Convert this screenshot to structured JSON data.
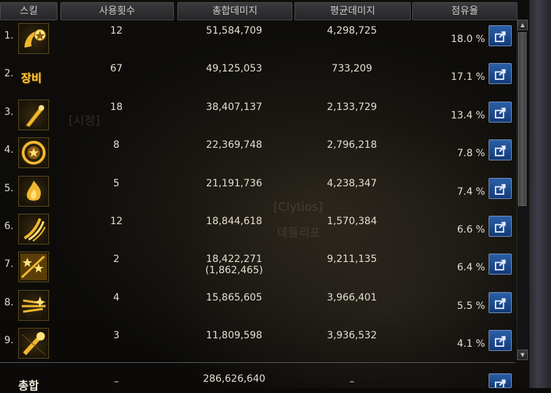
{
  "columns": {
    "skill": "스킬",
    "uses": "사용횟수",
    "total_damage": "총합데미지",
    "avg_damage": "평균데미지",
    "share": "점유율"
  },
  "rows": [
    {
      "rank": "1.",
      "icon": "swirl-star-skill-icon",
      "uses": "12",
      "total": "51,584,709",
      "total_sub": "",
      "avg": "4,298,725",
      "share": "18.0 %"
    },
    {
      "rank": "2.",
      "icon": "equipment-icon",
      "icon_text": "장비",
      "uses": "67",
      "total": "49,125,053",
      "total_sub": "",
      "avg": "733,209",
      "share": "17.1 %"
    },
    {
      "rank": "3.",
      "icon": "bat-skill-icon",
      "uses": "18",
      "total": "38,407,137",
      "total_sub": "",
      "avg": "2,133,729",
      "share": "13.4 %"
    },
    {
      "rank": "4.",
      "icon": "star-ring-skill-icon",
      "uses": "8",
      "total": "22,369,748",
      "total_sub": "",
      "avg": "2,796,218",
      "share": "7.8 %"
    },
    {
      "rank": "5.",
      "icon": "flame-skill-icon",
      "uses": "5",
      "total": "21,191,736",
      "total_sub": "",
      "avg": "4,238,347",
      "share": "7.4 %"
    },
    {
      "rank": "6.",
      "icon": "claw-slash-skill-icon",
      "uses": "12",
      "total": "18,844,618",
      "total_sub": "",
      "avg": "1,570,384",
      "share": "6.6 %"
    },
    {
      "rank": "7.",
      "icon": "star-burst-skill-icon",
      "uses": "2",
      "total": "18,422,271",
      "total_sub": "(1,862,465)",
      "avg": "9,211,135",
      "share": "6.4 %"
    },
    {
      "rank": "8.",
      "icon": "dash-spark-skill-icon",
      "uses": "4",
      "total": "15,865,605",
      "total_sub": "",
      "avg": "3,966,401",
      "share": "5.5 %"
    },
    {
      "rank": "9.",
      "icon": "comet-swing-skill-icon",
      "uses": "3",
      "total": "11,809,598",
      "total_sub": "",
      "avg": "3,936,532",
      "share": "4.1 %"
    }
  ],
  "total_row": {
    "label": "총합",
    "uses": "–",
    "total": "286,626,640",
    "avg": "–"
  },
  "background_text": {
    "name1": "[시정]",
    "name2": "[Clytios]",
    "name3": "데들리포"
  },
  "colors": {
    "accent_gold": "#ffcf3a",
    "button_blue": "#1f4f96",
    "header_bg": "#2e2e30"
  }
}
